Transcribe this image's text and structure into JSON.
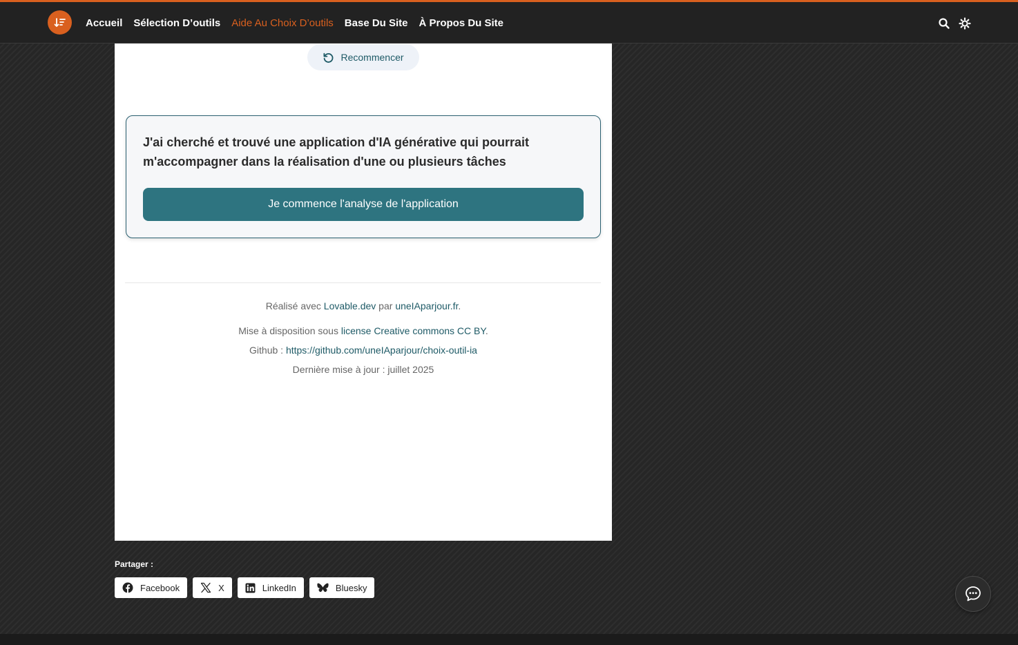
{
  "nav": {
    "items": [
      {
        "label": "Accueil"
      },
      {
        "label": "Sélection D’outils"
      },
      {
        "label": "Aide Au Choix D’outils"
      },
      {
        "label": "Base Du Site"
      },
      {
        "label": "À Propos Du Site"
      }
    ],
    "active_index": 2,
    "icons": [
      "sort-icon",
      "search-icon",
      "theme-toggle-icon"
    ]
  },
  "main": {
    "restart_label": "Recommencer",
    "info_text": "J'ai cherché et trouvé une application d'IA générative qui pourrait m'accompagner dans la réalisation d'une ou plusieurs tâches",
    "analyse_label": "Je commence l'analyse de l'application"
  },
  "footer": {
    "made_with_prefix": "Réalisé avec ",
    "made_with_link": "Lovable.dev",
    "by_text": " par ",
    "by_link": "uneIAparjour.fr",
    "by_suffix": ".",
    "license_prefix": "Mise à disposition sous ",
    "license_link": "license Creative commons CC BY",
    "license_suffix": ".",
    "github_prefix": "Github : ",
    "github_link": "https://github.com/uneIAparjour/choix-outil-ia",
    "updated": "Dernière mise à jour : juillet 2025"
  },
  "share": {
    "label": "Partager :",
    "buttons": [
      {
        "label": "Facebook",
        "icon": "facebook-icon"
      },
      {
        "label": "X",
        "icon": "x-icon"
      },
      {
        "label": "LinkedIn",
        "icon": "linkedin-icon"
      },
      {
        "label": "Bluesky",
        "icon": "bluesky-icon"
      }
    ]
  },
  "colors": {
    "accent": "#d9601f",
    "teal": "#2e7480",
    "link": "#1e5a66"
  }
}
